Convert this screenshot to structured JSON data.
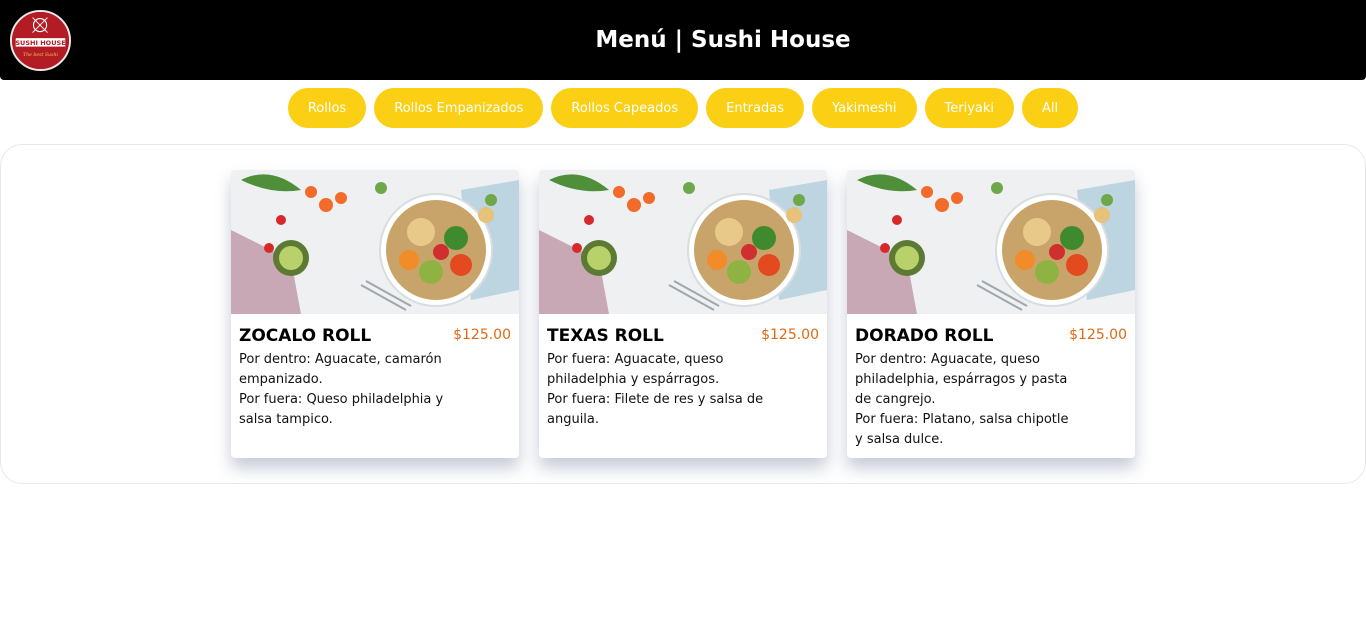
{
  "header": {
    "title": "Menú | Sushi House",
    "logo": {
      "name": "SUSHI HOUSE",
      "tagline": "The best Sushi",
      "color": "#b31c24"
    }
  },
  "filters": [
    "Rollos",
    "Rollos Empanizados",
    "Rollos Capeados",
    "Entradas",
    "Yakimeshi",
    "Teriyaki",
    "All"
  ],
  "colors": {
    "filter_bg": "#fbcf13",
    "price": "#e06a12"
  },
  "items": [
    {
      "name": "ZOCALO ROLL",
      "price": "$125.00",
      "line1": "Por dentro: Aguacate, camarón empanizado.",
      "line2": "Por fuera: Queso philadelphia y salsa tampico."
    },
    {
      "name": "TEXAS ROLL",
      "price": "$125.00",
      "line1": "Por fuera: Aguacate, queso philadelphia y espárragos.",
      "line2": "Por fuera: Filete de res y salsa de anguila."
    },
    {
      "name": "DORADO ROLL",
      "price": "$125.00",
      "line1": "Por dentro: Aguacate, queso philadelphia, espárragos y pasta de cangrejo.",
      "line2": "Por fuera: Platano, salsa chipotle y salsa dulce."
    }
  ]
}
